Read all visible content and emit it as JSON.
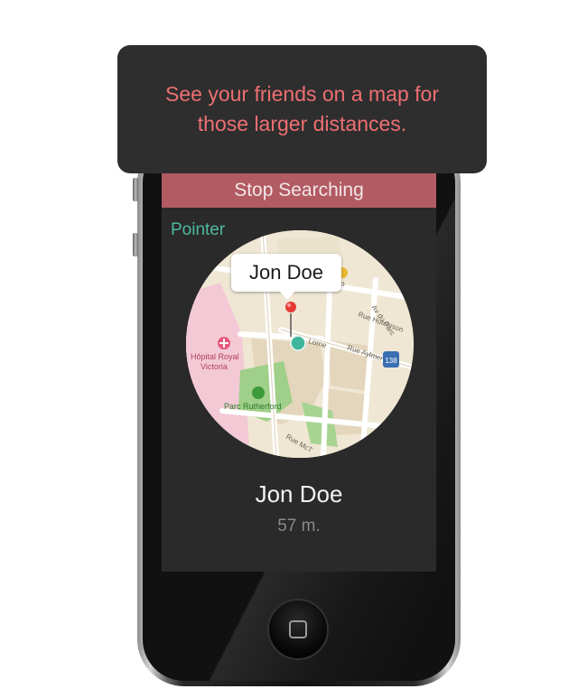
{
  "tooltip": {
    "text": "See your friends on a map for those larger distances."
  },
  "screen": {
    "stop_button_label": "Stop Searching",
    "mode_label": "Pointer",
    "map": {
      "callout_name": "Jon Doe",
      "labels": {
        "hospital": "Hôpital Royal Victoria",
        "hospital_line1": "Hôpital Royal",
        "hospital_line2": "Victoria",
        "park": "Parc Rutherford",
        "street_av_du_parc": "Av du Parc",
        "street_hutchison": "Rue Hutchison",
        "street_aylmer": "Rue Aylmer",
        "street_mct": "Rue McT",
        "street_lorne": "Lorne",
        "partial_label": "ero",
        "route_badge": "138"
      },
      "colors": {
        "background": "#efe7d4",
        "block": "#e3d6bc",
        "park": "#9fcf88",
        "hospital": "#f3c9d6",
        "road": "#ffffff",
        "pin": "#e53935",
        "user_dot": "#3fb59b"
      }
    },
    "friend": {
      "name": "Jon Doe",
      "distance": "57 m."
    }
  },
  "icons": {
    "pin": "map-pin-icon",
    "user": "user-location-icon",
    "hospital": "hospital-icon",
    "park": "park-icon",
    "route": "route-shield-icon",
    "poi": "poi-icon",
    "home": "home-button-icon"
  }
}
